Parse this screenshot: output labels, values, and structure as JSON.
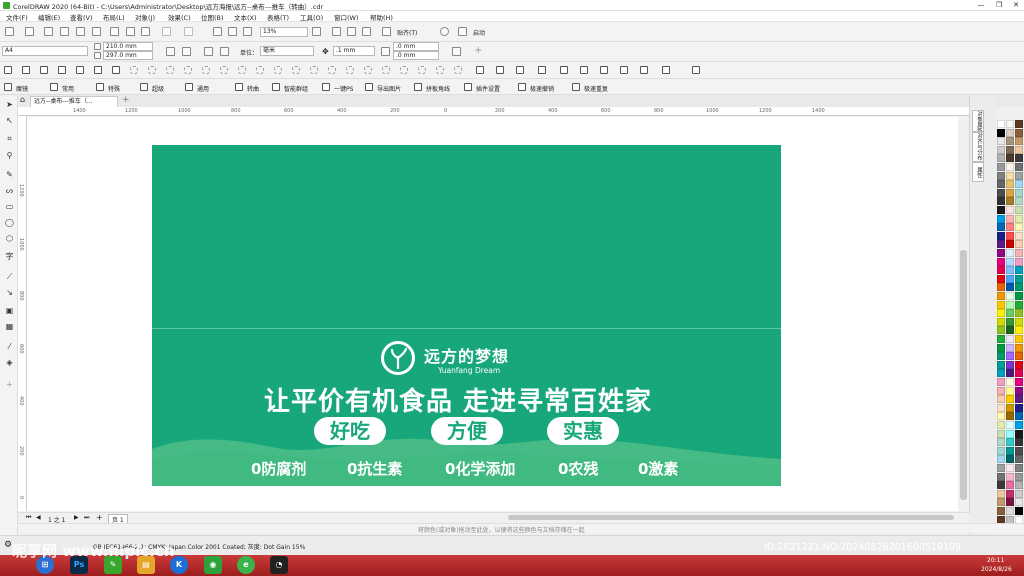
{
  "window": {
    "title": "CorelDRAW 2020 (64-Bit) - C:\\Users\\Administrator\\Desktop\\远方海报\\远方--桌布---推车（转曲）.cdr",
    "controls": [
      "—",
      "❐",
      "✕"
    ]
  },
  "menu": [
    "文件(F)",
    "编辑(E)",
    "查看(V)",
    "布局(L)",
    "对象(J)",
    "效果(C)",
    "位图(B)",
    "文本(X)",
    "表格(T)",
    "工具(O)",
    "窗口(W)",
    "帮助(H)"
  ],
  "standard_toolbar": {
    "zoom": "13%",
    "snap_label": "贴齐(T)",
    "launch_label": "启动"
  },
  "property_bar": {
    "page_size": "A4",
    "width": "210.0 mm",
    "height": "297.0 mm",
    "units_label": "单位：",
    "units": "毫米",
    "nudge": ".1 mm",
    "dup_x": ".0 mm",
    "dup_y": ".0 mm"
  },
  "plugin_bar": [
    "魔镜",
    "常用",
    "特殊",
    "超级",
    "通用",
    "转曲",
    "智能群组",
    "一键PS",
    "导出图片",
    "拼板角线",
    "插件设置",
    "极速撤销",
    "极速重复"
  ],
  "document_tab": "远方--桌布---推车（...",
  "ruler_h": [
    "1400",
    "1200",
    "1000",
    "800",
    "600",
    "400",
    "200",
    "0",
    "200",
    "400",
    "600",
    "800",
    "1000",
    "1200",
    "1400"
  ],
  "ruler_v": [
    "1200",
    "1000",
    "800",
    "600",
    "400",
    "200",
    "0"
  ],
  "design": {
    "background": "#17a77b",
    "brand_cn": "远方的梦想",
    "brand_en": "Yuanfang Dream",
    "slogan": "让平价有机食品 走进寻常百姓家",
    "pills": [
      "好吃",
      "方便",
      "实惠"
    ],
    "features": [
      "0防腐剂",
      "0抗生素",
      "0化学添加",
      "0农残",
      "0激素"
    ]
  },
  "dockers": [
    "对象属性",
    "对齐与分布",
    "属性"
  ],
  "page_nav": {
    "counter": "1 之 1",
    "page_tab": "页 1"
  },
  "hint": "将颜色(或对象)拖动至此处，以便将这些颜色与文档存储在一起",
  "status": "GB IEC61966-2.1; CMYK: Japan Color 2001 Coated; 灰度: Dot Gain 15%",
  "watermark": {
    "site": "昵享网 www.nipic.cn",
    "id": "ID:2621221 NO:20240826201600519109"
  },
  "clock": {
    "time": "20:11",
    "date": "2024/8/26"
  }
}
